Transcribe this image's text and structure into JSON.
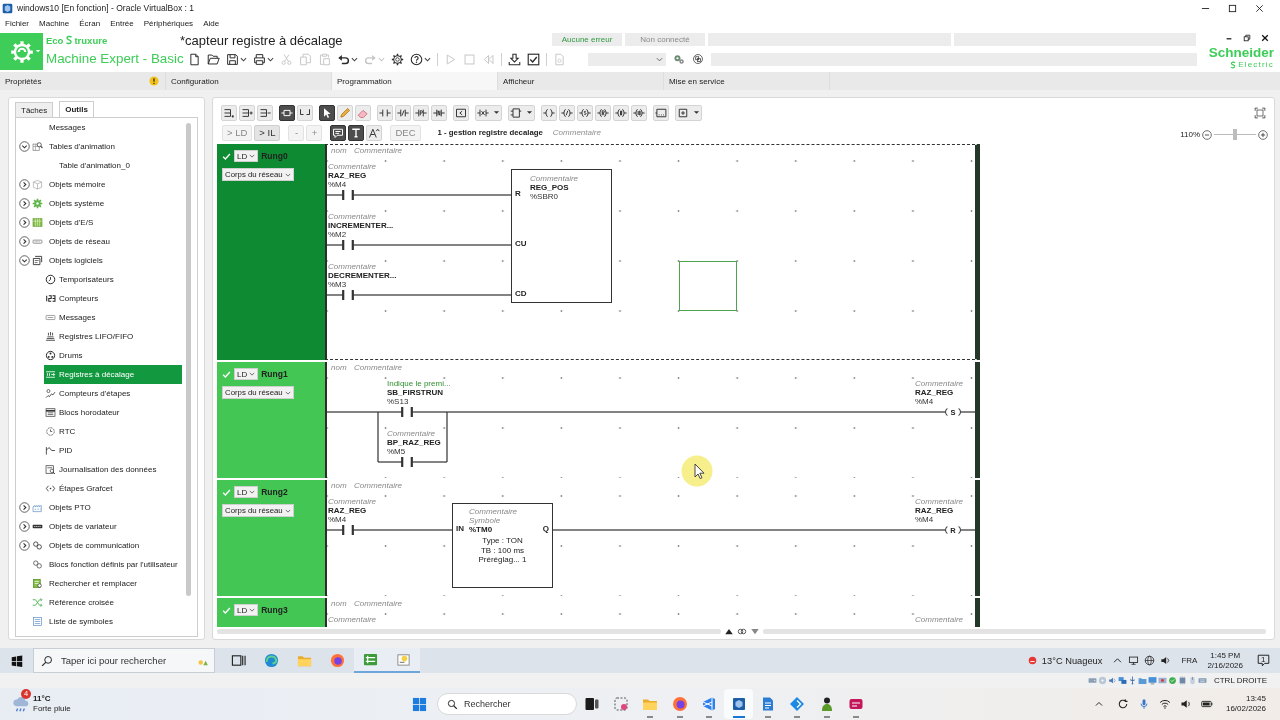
{
  "vbox": {
    "title": "windows10 [En fonction] - Oracle VirtualBox : 1",
    "menu": [
      "Fichier",
      "Machine",
      "Écran",
      "Entrée",
      "Périphériques",
      "Aide"
    ],
    "host_key": "CTRL DROITE"
  },
  "app": {
    "brand_start": "Eco",
    "brand_end": "truxure",
    "product": "Machine Expert - Basic",
    "document": "*capteur registre à décalage",
    "statuses": [
      {
        "label": "Aucune erreur",
        "kind": "ok"
      },
      {
        "label": "Non connecté",
        "kind": "offline"
      }
    ],
    "vendor": "Schneider",
    "vendor_line": "Electric",
    "toolbar": [
      {
        "buttons": [
          {
            "kind": "new",
            "disabled": false,
            "dropdown": false
          },
          {
            "kind": "open",
            "disabled": false,
            "dropdown": false
          },
          {
            "kind": "save",
            "disabled": false,
            "dropdown": true
          },
          {
            "kind": "print",
            "disabled": false,
            "dropdown": true
          },
          {
            "kind": "cut",
            "disabled": true,
            "dropdown": false
          },
          {
            "kind": "copy",
            "disabled": true,
            "dropdown": false
          },
          {
            "kind": "paste",
            "disabled": true,
            "dropdown": false
          },
          {
            "kind": "undo",
            "disabled": false,
            "dropdown": true
          },
          {
            "kind": "redo",
            "disabled": true,
            "dropdown": true
          },
          {
            "kind": "settings",
            "disabled": false,
            "dropdown": false
          },
          {
            "kind": "help",
            "disabled": false,
            "dropdown": true
          }
        ]
      },
      {
        "buttons": [
          {
            "kind": "run",
            "disabled": true,
            "dropdown": false
          },
          {
            "kind": "stop",
            "disabled": true,
            "dropdown": false
          },
          {
            "kind": "rewind",
            "disabled": true,
            "dropdown": false
          }
        ]
      },
      {
        "buttons": [
          {
            "kind": "download",
            "disabled": false,
            "dropdown": false
          },
          {
            "kind": "check",
            "disabled": false,
            "dropdown": false
          }
        ]
      },
      {
        "buttons": [
          {
            "kind": "report",
            "disabled": true,
            "dropdown": false
          }
        ]
      }
    ]
  },
  "tabs": [
    {
      "label": "Propriétés",
      "selected": false,
      "warning": true
    },
    {
      "label": "Configuration",
      "selected": false,
      "warning": false
    },
    {
      "label": "Programmation",
      "selected": true,
      "warning": false
    },
    {
      "label": "Afficheur",
      "selected": false,
      "warning": false
    },
    {
      "label": "Mise en service",
      "selected": false,
      "warning": false
    }
  ],
  "sidebar": {
    "tabs": [
      {
        "label": "Tâches",
        "selected": false
      },
      {
        "label": "Outils",
        "selected": true
      }
    ],
    "tree": [
      {
        "label": "Messages",
        "kind": "none",
        "selected": false
      },
      {
        "label": "Tables d'animation",
        "kind": "animation",
        "selected": false,
        "expanded": true,
        "children": [
          {
            "label": "Table d'animation_0",
            "kind": "none",
            "selected": false
          }
        ]
      },
      {
        "label": "Objets mémoire",
        "kind": "memory",
        "selected": false,
        "expanded": false
      },
      {
        "label": "Objets système",
        "kind": "system",
        "selected": false,
        "expanded": false
      },
      {
        "label": "Objets d'E/S",
        "kind": "io",
        "selected": false,
        "expanded": false
      },
      {
        "label": "Objets de réseau",
        "kind": "network",
        "selected": false,
        "expanded": false
      },
      {
        "label": "Objets logiciels",
        "kind": "software",
        "selected": false,
        "expanded": true,
        "children": [
          {
            "label": "Temporisateurs",
            "kind": "timer",
            "selected": false
          },
          {
            "label": "Compteurs",
            "kind": "counter",
            "selected": false
          },
          {
            "label": "Messages",
            "kind": "message",
            "selected": false
          },
          {
            "label": "Registres LIFO/FIFO",
            "kind": "lifo",
            "selected": false
          },
          {
            "label": "Drums",
            "kind": "drum",
            "selected": false
          },
          {
            "label": "Registres à décalage",
            "kind": "shift",
            "selected": true
          },
          {
            "label": "Compteurs d'étapes",
            "kind": "step",
            "selected": false
          },
          {
            "label": "Blocs horodateur",
            "kind": "schedule",
            "selected": false
          },
          {
            "label": "RTC",
            "kind": "rtc",
            "selected": false
          },
          {
            "label": "PID",
            "kind": "pid",
            "selected": false
          },
          {
            "label": "Journalisation des données",
            "kind": "log",
            "selected": false
          },
          {
            "label": "Étapes Grafcet",
            "kind": "grafcet",
            "selected": false
          }
        ]
      },
      {
        "label": "Objets PTO",
        "kind": "pto",
        "selected": false,
        "expanded": false
      },
      {
        "label": "Objets de variateur",
        "kind": "drive",
        "selected": false,
        "expanded": false
      },
      {
        "label": "Objets de communication",
        "kind": "comm",
        "selected": false,
        "expanded": false
      },
      {
        "label": "Blocs fonction définis par l'utilisateur",
        "kind": "udfb",
        "selected": false
      },
      {
        "label": "Rechercher et remplacer",
        "kind": "search",
        "selected": false
      },
      {
        "label": "Référence croisée",
        "kind": "xref",
        "selected": false
      },
      {
        "label": "Liste de symboles",
        "kind": "symbols",
        "selected": false
      }
    ]
  },
  "editor": {
    "toolbar": [
      {
        "buttons": [
          {
            "kind": "rung-insert",
            "pressed": false,
            "dropdown": false
          },
          {
            "kind": "rung-add",
            "pressed": false,
            "dropdown": false
          },
          {
            "kind": "rung-remove",
            "pressed": false,
            "dropdown": false
          }
        ]
      },
      {
        "buttons": [
          {
            "kind": "branch-open",
            "pressed": true,
            "dropdown": false
          },
          {
            "kind": "branch-close",
            "pressed": false,
            "dropdown": false
          }
        ]
      },
      {
        "buttons": [
          {
            "kind": "select",
            "pressed": true,
            "dropdown": false
          },
          {
            "kind": "pencil",
            "pressed": false,
            "dropdown": false
          },
          {
            "kind": "eraser",
            "pressed": false,
            "dropdown": false
          }
        ]
      },
      {
        "buttons": [
          {
            "kind": "contact",
            "pressed": false,
            "dropdown": false
          },
          {
            "kind": "contact-nc",
            "pressed": false,
            "dropdown": false
          },
          {
            "kind": "contact-rise",
            "pressed": false,
            "dropdown": false
          },
          {
            "kind": "contact-fall",
            "pressed": false,
            "dropdown": false
          }
        ]
      },
      {
        "buttons": [
          {
            "kind": "compare",
            "pressed": false,
            "dropdown": false
          }
        ]
      },
      {
        "buttons": [
          {
            "kind": "contact-cross",
            "pressed": false,
            "dropdown": true
          }
        ]
      },
      {
        "buttons": [
          {
            "kind": "block",
            "pressed": false,
            "dropdown": true
          }
        ]
      },
      {
        "buttons": [
          {
            "kind": "coil",
            "pressed": false,
            "dropdown": false
          },
          {
            "kind": "coil-nc",
            "pressed": false,
            "dropdown": false
          },
          {
            "kind": "coil-set",
            "pressed": false,
            "dropdown": false
          },
          {
            "kind": "coil-reset",
            "pressed": false,
            "dropdown": false
          },
          {
            "kind": "coil-jump",
            "pressed": false,
            "dropdown": false
          },
          {
            "kind": "coil-call",
            "pressed": false,
            "dropdown": false
          }
        ]
      },
      {
        "buttons": [
          {
            "kind": "operation",
            "pressed": false,
            "dropdown": false
          }
        ]
      },
      {
        "buttons": [
          {
            "kind": "add",
            "pressed": false,
            "dropdown": true
          }
        ]
      }
    ],
    "actions": [
      {
        "buttons": [
          {
            "kind": "text",
            "label": "> LD",
            "disabled": true,
            "pressed": false
          },
          {
            "kind": "text",
            "label": "> IL",
            "disabled": false,
            "pressed": false
          }
        ]
      },
      {
        "buttons": [
          {
            "kind": "text",
            "label": "-",
            "disabled": true,
            "pressed": false
          },
          {
            "kind": "text",
            "label": "+",
            "disabled": true,
            "pressed": false
          }
        ]
      },
      {
        "buttons": [
          {
            "kind": "comment",
            "disabled": false,
            "pressed": true
          },
          {
            "kind": "text-tool",
            "disabled": false,
            "pressed": true
          },
          {
            "kind": "font-size",
            "disabled": false,
            "pressed": false
          }
        ]
      },
      {
        "buttons": [
          {
            "kind": "text",
            "label": "DEC",
            "disabled": true,
            "pressed": false
          }
        ]
      }
    ],
    "section_title": "1 - gestion registre decalage",
    "section_comment": {
      "placeholder": "Commentaire"
    },
    "zoom": {
      "label": "110%",
      "level": 0.5
    }
  },
  "rungs": [
    {
      "kind": "block",
      "name": "Rung0",
      "language": "LD",
      "section": "Corps du réseau",
      "selected": true,
      "name_field": {
        "placeholder": "nom"
      },
      "comment_field": {
        "placeholder": "Commentaire"
      },
      "inputs": [
        {
          "comment": {
            "placeholder": "Commentaire"
          },
          "symbol": "RAZ_REG",
          "address": "%M4",
          "pin": "R"
        },
        {
          "comment": {
            "placeholder": "Commentaire"
          },
          "symbol": "INCREMENTER...",
          "address": "%M2",
          "pin": "CU"
        },
        {
          "comment": {
            "placeholder": "Commentaire"
          },
          "symbol": "DECREMENTER...",
          "address": "%M3",
          "pin": "CD"
        }
      ],
      "block": {
        "comment": {
          "placeholder": "Commentaire"
        },
        "symbol": "REG_POS",
        "address": "%SBR0"
      }
    },
    {
      "kind": "parallel",
      "name": "Rung1",
      "language": "LD",
      "section": "Corps du réseau",
      "selected": false,
      "name_field": {
        "placeholder": "nom"
      },
      "comment_field": {
        "placeholder": "Commentaire"
      },
      "contacts": [
        {
          "comment": {
            "value": "Indique le premi..."
          },
          "symbol": "SB_FIRSTRUN",
          "address": "%S13"
        },
        {
          "comment": {
            "placeholder": "Commentaire"
          },
          "symbol": "BP_RAZ_REG",
          "address": "%M5"
        }
      ],
      "coil": {
        "comment": {
          "placeholder": "Commentaire"
        },
        "symbol": "RAZ_REG",
        "address": "%M4",
        "label": "S"
      }
    },
    {
      "kind": "series",
      "name": "Rung2",
      "language": "LD",
      "section": "Corps du réseau",
      "selected": false,
      "name_field": {
        "placeholder": "nom"
      },
      "comment_field": {
        "placeholder": "Commentaire"
      },
      "contacts": [
        {
          "comment": {
            "placeholder": "Commentaire"
          },
          "symbol": "RAZ_REG",
          "address": "%M4"
        }
      ],
      "timer": {
        "input": "IN",
        "output": "Q",
        "comment": {
          "placeholder": "Commentaire"
        },
        "symbol": {
          "placeholder": "Symbole"
        },
        "address": "%TM0",
        "params": [
          "Type : TON",
          "TB : 100 ms",
          "Préréglag... 1"
        ]
      },
      "coil": {
        "comment": {
          "placeholder": "Commentaire"
        },
        "symbol": "RAZ_REG",
        "address": "%M4",
        "label": "R"
      }
    },
    {
      "kind": "partial",
      "name": "Rung3",
      "language": "LD",
      "selected": false,
      "name_field": {
        "placeholder": "nom"
      },
      "comment_field": {
        "placeholder": "Commentaire"
      },
      "contacts": [
        {
          "comment": {
            "placeholder": "Commentaire"
          }
        }
      ],
      "coil": {
        "comment": {
          "placeholder": "Commentaire"
        }
      }
    }
  ],
  "guest_taskbar": {
    "search": {
      "placeholder": "Taper ici pour rechercher"
    },
    "apps": [
      {
        "kind": "task-view",
        "running": false
      },
      {
        "kind": "swirl-browser",
        "running": false
      },
      {
        "kind": "folder",
        "running": false
      },
      {
        "kind": "fox-browser",
        "running": false
      },
      {
        "kind": "ladder-app",
        "running": true
      },
      {
        "kind": "bulb-app",
        "running": true
      }
    ],
    "weather": "13°C Nuageux",
    "language": "FRA",
    "time": "1:45 PM",
    "date": "2/16/2026",
    "notifications": "1"
  },
  "host_taskbar": {
    "weather": {
      "badge": "4",
      "temperature": "11°C",
      "condition": "Forte pluie"
    },
    "search": {
      "placeholder": "Rechercher"
    },
    "apps": [
      {
        "kind": "task-view",
        "running": false,
        "active": false
      },
      {
        "kind": "snip",
        "running": false,
        "active": false
      },
      {
        "kind": "folder",
        "running": true,
        "active": false
      },
      {
        "kind": "fox-browser",
        "running": true,
        "active": false
      },
      {
        "kind": "code",
        "running": true,
        "active": false
      },
      {
        "kind": "vm",
        "running": true,
        "active": true
      },
      {
        "kind": "doc",
        "running": true,
        "active": false
      },
      {
        "kind": "diamond",
        "running": true,
        "active": false
      },
      {
        "kind": "figure",
        "running": true,
        "active": false
      },
      {
        "kind": "chat",
        "running": true,
        "active": false
      }
    ],
    "time": "13:45",
    "date": "16/02/2026"
  }
}
